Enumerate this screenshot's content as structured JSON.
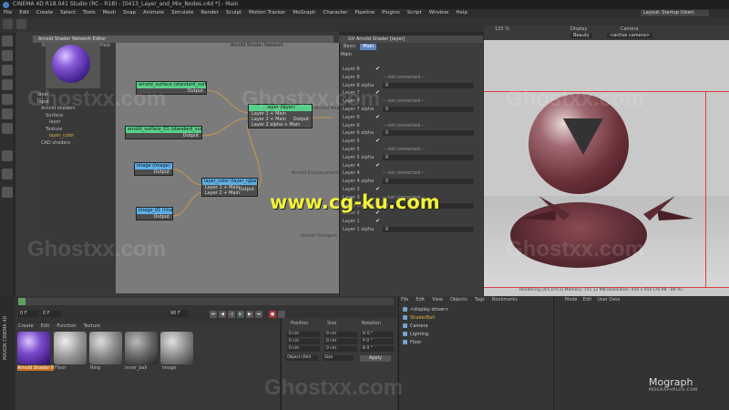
{
  "window": {
    "title": "CINEMA 4D R18.041 Studio (RC - R18) - [0413_Layer_and_Mix_Nodes.c4d *] - Main"
  },
  "menubar": [
    "File",
    "Edit",
    "Create",
    "Select",
    "Tools",
    "Mesh",
    "Snap",
    "Animate",
    "Simulate",
    "Render",
    "Sculpt",
    "Motion Tracker",
    "MoGraph",
    "Character",
    "Pipeline",
    "Plugins",
    "Script",
    "Window",
    "Help"
  ],
  "layout": {
    "label": "Layout:",
    "value": "Startup (User)"
  },
  "editor": {
    "title": "Arnold Shader Network Editor",
    "menu": [
      "Edit",
      "View",
      "Texture",
      "Help"
    ],
    "network_title": "Arnold Shader Network",
    "tree": [
      "layer",
      "Input",
      "Arnold shaders",
      "Surface",
      "layer",
      "Texture",
      "layer_color",
      "CAD shaders"
    ],
    "nodes": {
      "std1": {
        "title": "arnold_surface (standard_surface)",
        "out": "Output"
      },
      "std2": {
        "title": "arnold_surface_01 (standard_surface)",
        "out": "Output"
      },
      "layer": {
        "title": "layer (layer)",
        "rows": [
          "Layer 1 + Main",
          "Layer 2 + Main",
          "Layer 2 alpha + Main"
        ],
        "out": "Output"
      },
      "image": {
        "title": "image (image)",
        "out": "Output"
      },
      "image2": {
        "title": "image_01 (image)",
        "out": "Output"
      },
      "layer_color": {
        "title": "layer_color (layer_rgba)",
        "rows": [
          "Layer 1 + Main",
          "Layer 2 + Main"
        ],
        "out": "Output"
      }
    },
    "side_labels": [
      "Arnold Beauty",
      "Arnold Displacement",
      "Arnold Viewport"
    ]
  },
  "props": {
    "title": "GV Arnold Shader [layer]",
    "tabs": [
      "Basic",
      "Main"
    ],
    "section": "Main",
    "rows": [
      {
        "label": "Layer 8",
        "kind": "check"
      },
      {
        "label": "Layer 8",
        "kind": "nc",
        "value": "-- not connected --"
      },
      {
        "label": "Layer 8 alpha",
        "kind": "val",
        "value": "0"
      },
      {
        "label": "Layer 7",
        "kind": "check"
      },
      {
        "label": "Layer 7",
        "kind": "nc",
        "value": "-- not connected --"
      },
      {
        "label": "Layer 7 alpha",
        "kind": "val",
        "value": "0"
      },
      {
        "label": "Layer 6",
        "kind": "check"
      },
      {
        "label": "Layer 6",
        "kind": "nc",
        "value": "-- not connected --"
      },
      {
        "label": "Layer 6 alpha",
        "kind": "val",
        "value": "0"
      },
      {
        "label": "Layer 5",
        "kind": "check"
      },
      {
        "label": "Layer 5",
        "kind": "nc",
        "value": "-- not connected --"
      },
      {
        "label": "Layer 5 alpha",
        "kind": "val",
        "value": "0"
      },
      {
        "label": "Layer 4",
        "kind": "check"
      },
      {
        "label": "Layer 4",
        "kind": "nc",
        "value": "-- not connected --"
      },
      {
        "label": "Layer 4 alpha",
        "kind": "val",
        "value": "0"
      },
      {
        "label": "Layer 3",
        "kind": "check"
      },
      {
        "label": "Layer 3",
        "kind": "nc",
        "value": "-- not connected --"
      },
      {
        "label": "Layer 3 alpha",
        "kind": "val",
        "value": "0"
      },
      {
        "label": "Layer 2",
        "kind": "check"
      },
      {
        "label": "Layer 1",
        "kind": "check"
      },
      {
        "label": "Layer 1 alpha",
        "kind": "val",
        "value": "0"
      }
    ]
  },
  "viewport": {
    "display_label": "Display",
    "display_value": "Beauty",
    "camera_label": "Camera",
    "camera_value": "<active camera>",
    "zoom": "125 %",
    "stats": "Rendering [4/5,0:0:2]  Memory: 755.12 MB  Resolution: 450 x 450 (76.98 - 89 %)"
  },
  "timeline": {
    "start": "0 F",
    "end": "90 F",
    "current": "0 F"
  },
  "materials": {
    "menu": [
      "Create",
      "Edit",
      "Function",
      "Texture"
    ],
    "items": [
      {
        "label": "Arnold Shader N"
      },
      {
        "label": "Floor"
      },
      {
        "label": "Ring"
      },
      {
        "label": "inner_ball"
      },
      {
        "label": "image"
      }
    ]
  },
  "coords": {
    "headers": [
      "Position",
      "Size",
      "Rotation"
    ],
    "rows": [
      {
        "axis": "X",
        "pos": "0 cm",
        "size": "0 cm",
        "rot": "H 0 °"
      },
      {
        "axis": "Y",
        "pos": "0 cm",
        "size": "0 cm",
        "rot": "P 0 °"
      },
      {
        "axis": "Z",
        "pos": "0 cm",
        "size": "0 cm",
        "rot": "B 0 °"
      }
    ],
    "mode": "Object (Rel)",
    "size_mode": "Size",
    "apply": "Apply"
  },
  "objects": {
    "menu": [
      "File",
      "Edit",
      "View",
      "Objects",
      "Tags",
      "Bookmarks"
    ],
    "items": [
      "<display driver>",
      "ShaderBall",
      "Camera",
      "Lighting",
      "Floor"
    ]
  },
  "attributes": {
    "menu": [
      "Mode",
      "Edit",
      "User Data"
    ]
  },
  "brand": {
    "name": "Mograph",
    "sub": "MOGRAPHPLUS.COM",
    "maxon": "MAXON CINEMA 4D"
  },
  "watermark": {
    "main": "www.cg-ku.com",
    "ghost": "Ghostxx.com"
  },
  "colors": {
    "accent": "#5f86c0",
    "node_green": "#59d08a",
    "node_blue": "#5fb0e8",
    "guide_red": "#d94040"
  }
}
